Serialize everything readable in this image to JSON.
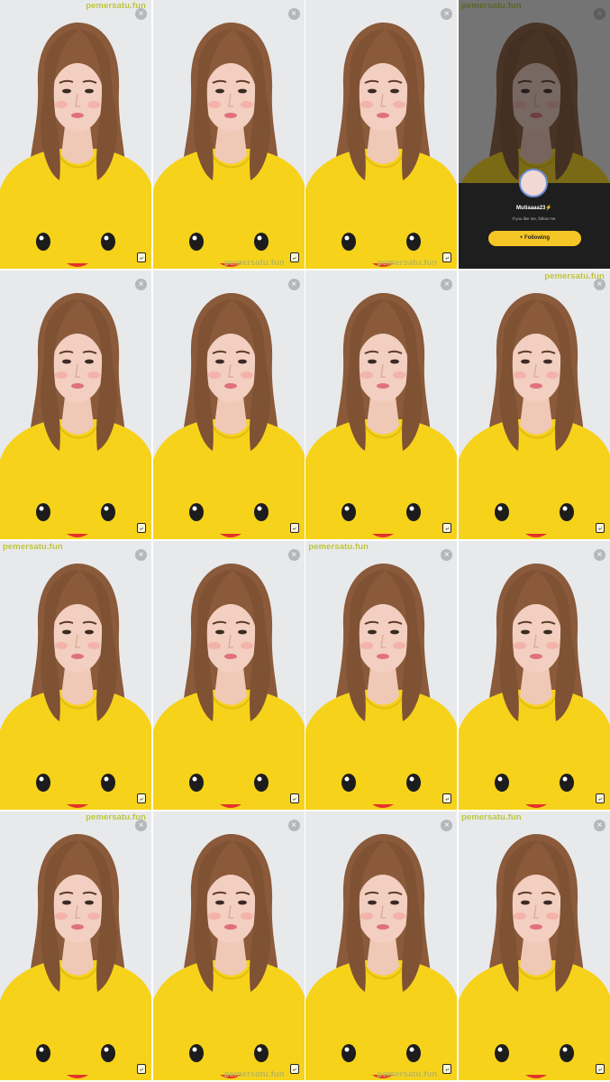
{
  "watermark_text": "pemersatu.fun",
  "close_glyph": "×",
  "share_glyph": "⤶",
  "colors": {
    "shirt": "#f6d21a",
    "hair": "#8a5a3a",
    "skin": "#f2cfc0",
    "background": "#e7e8ea",
    "watermark": "#b9c43a",
    "follow_button": "#f5c625"
  },
  "icons": {
    "close": "close-icon",
    "share": "share-icon"
  },
  "follow_card": {
    "username": "Mutiaaaa23⚡",
    "tagline": "If you like me, follow me.",
    "button_label": "+ Following"
  },
  "frames": [
    {
      "wm": "tr"
    },
    {
      "wm": "br"
    },
    {
      "wm": "br"
    },
    {
      "wm": "tl"
    },
    {
      "wm": "none"
    },
    {
      "wm": "none"
    },
    {
      "wm": "none"
    },
    {
      "wm": "tr"
    },
    {
      "wm": "tl"
    },
    {
      "wm": "none"
    },
    {
      "wm": "tl"
    },
    {
      "wm": "none"
    },
    {
      "wm": "tr"
    },
    {
      "wm": "br"
    },
    {
      "wm": "br"
    },
    {
      "wm": "tl"
    }
  ]
}
